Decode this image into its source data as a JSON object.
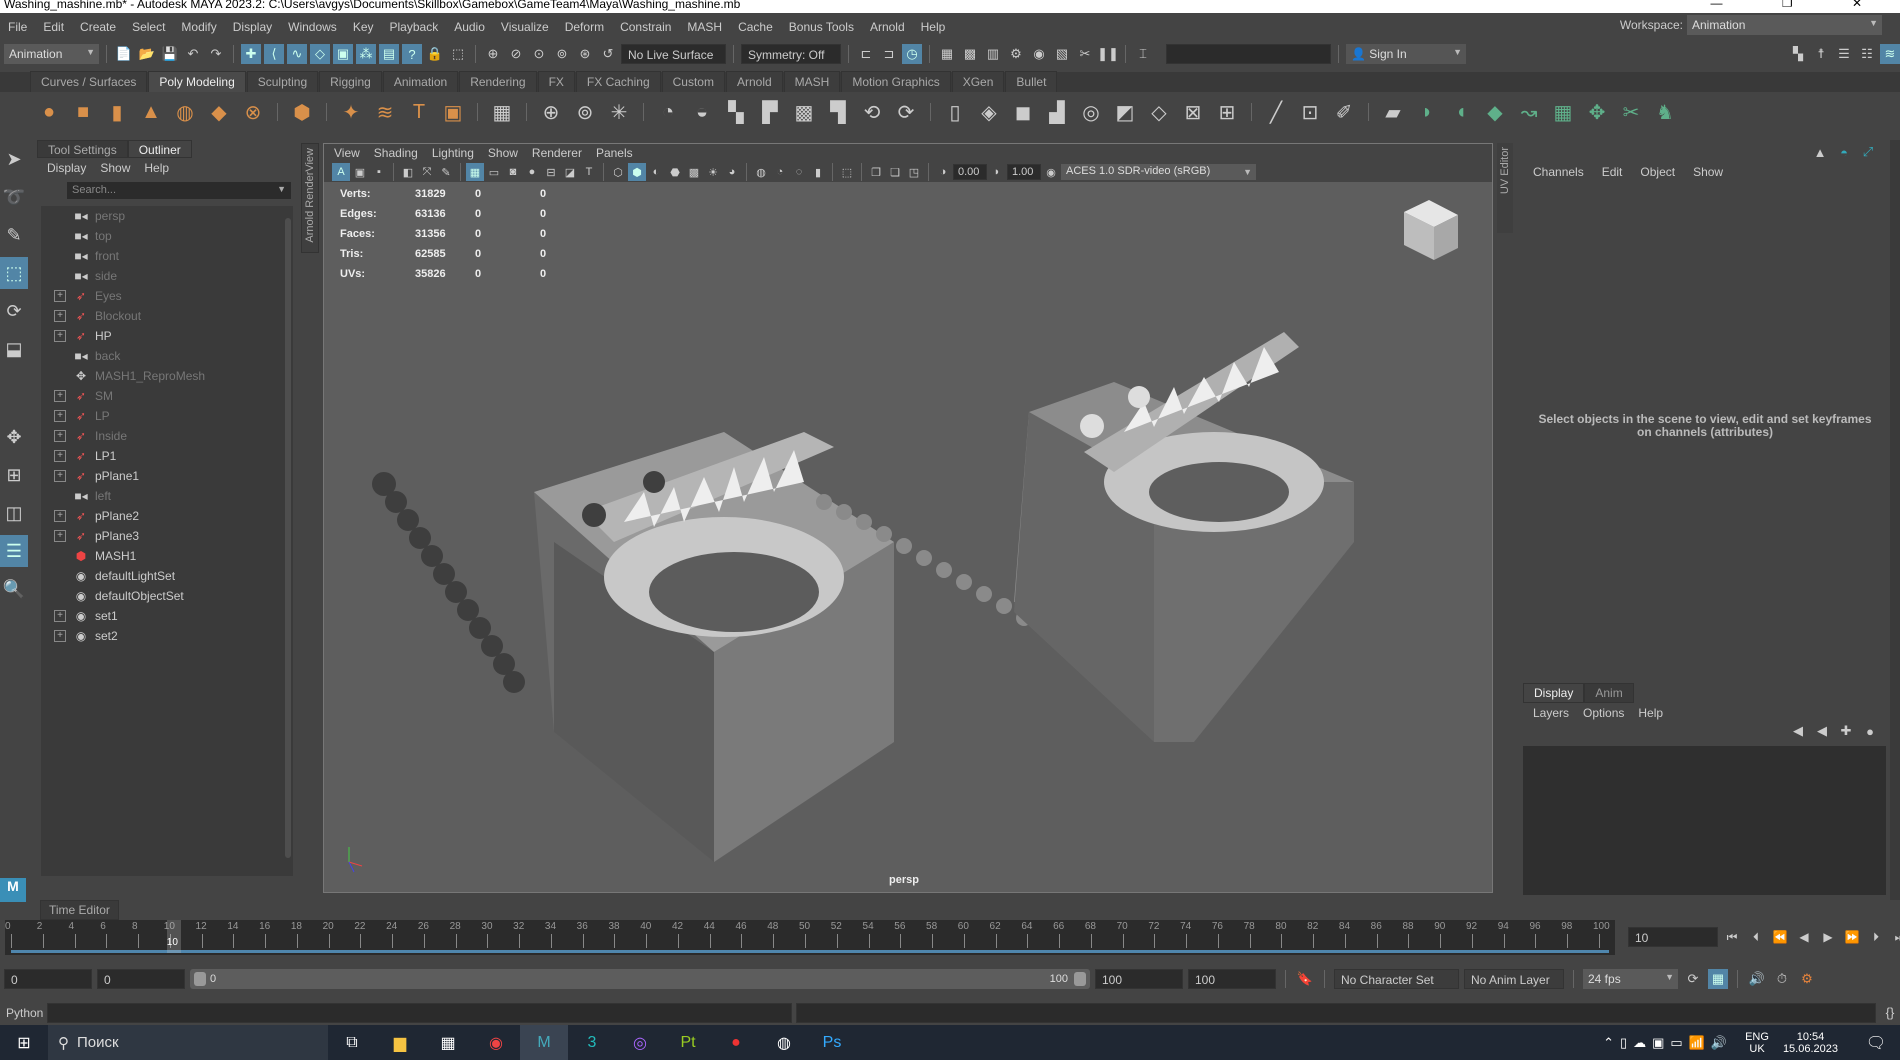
{
  "window": {
    "title": "Washing_mashine.mb* - Autodesk MAYA 2023.2: C:\\Users\\avgys\\Documents\\Skillbox\\Gamebox\\GameTeam4\\Maya\\Washing_mashine.mb",
    "controls": "—  ❐  ✕"
  },
  "menubar": {
    "items": [
      "File",
      "Edit",
      "Create",
      "Select",
      "Modify",
      "Display",
      "Windows",
      "Key",
      "Playback",
      "Audio",
      "Visualize",
      "Deform",
      "Constrain",
      "MASH",
      "Cache",
      "Bonus Tools",
      "Arnold",
      "Help"
    ],
    "workspace_label": "Workspace:",
    "workspace_value": "Animation"
  },
  "statusline": {
    "menuset": "Animation",
    "live_surface": "No Live Surface",
    "symmetry": "Symmetry: Off",
    "sign_in": "Sign In"
  },
  "shelf": {
    "tabs": [
      "Curves / Surfaces",
      "Poly Modeling",
      "Sculpting",
      "Rigging",
      "Animation",
      "Rendering",
      "FX",
      "FX Caching",
      "Custom",
      "Arnold",
      "MASH",
      "Motion Graphics",
      "XGen",
      "Bullet"
    ],
    "active_tab": "Poly Modeling",
    "accent": "#d9904a"
  },
  "outliner": {
    "tabs": [
      "Tool Settings",
      "Outliner"
    ],
    "active_tab": "Outliner",
    "menu": [
      "Display",
      "Show",
      "Help"
    ],
    "search_placeholder": "Search...",
    "items": [
      {
        "name": "persp",
        "icon": "camera",
        "expand": false,
        "dim": true
      },
      {
        "name": "top",
        "icon": "camera",
        "expand": false,
        "dim": true
      },
      {
        "name": "front",
        "icon": "camera",
        "expand": false,
        "dim": true
      },
      {
        "name": "side",
        "icon": "camera",
        "expand": false,
        "dim": true
      },
      {
        "name": "Eyes",
        "icon": "group",
        "expand": true,
        "dim": true
      },
      {
        "name": "Blockout",
        "icon": "group",
        "expand": true,
        "dim": true
      },
      {
        "name": "HP",
        "icon": "group",
        "expand": true,
        "dim": false
      },
      {
        "name": "back",
        "icon": "camera",
        "expand": false,
        "dim": true
      },
      {
        "name": "MASH1_ReproMesh",
        "icon": "mesh",
        "expand": false,
        "dim": true
      },
      {
        "name": "SM",
        "icon": "group",
        "expand": true,
        "dim": true
      },
      {
        "name": "LP",
        "icon": "group",
        "expand": true,
        "dim": true
      },
      {
        "name": "Inside",
        "icon": "group",
        "expand": true,
        "dim": true
      },
      {
        "name": "LP1",
        "icon": "group",
        "expand": true,
        "dim": false
      },
      {
        "name": "pPlane1",
        "icon": "group",
        "expand": true,
        "dim": false
      },
      {
        "name": "left",
        "icon": "camera",
        "expand": false,
        "dim": true
      },
      {
        "name": "pPlane2",
        "icon": "group",
        "expand": true,
        "dim": false
      },
      {
        "name": "pPlane3",
        "icon": "group",
        "expand": true,
        "dim": false
      },
      {
        "name": "MASH1",
        "icon": "mash",
        "expand": false,
        "dim": false
      },
      {
        "name": "defaultLightSet",
        "icon": "set",
        "expand": false,
        "dim": false
      },
      {
        "name": "defaultObjectSet",
        "icon": "set",
        "expand": false,
        "dim": false
      },
      {
        "name": "set1",
        "icon": "set",
        "expand": true,
        "dim": false
      },
      {
        "name": "set2",
        "icon": "set",
        "expand": true,
        "dim": false
      }
    ]
  },
  "side_tabs": {
    "arnold": "Arnold RenderView",
    "uv": "UV Editor"
  },
  "viewport": {
    "menu": [
      "View",
      "Shading",
      "Lighting",
      "Show",
      "Renderer",
      "Panels"
    ],
    "exposure": "0.00",
    "gamma": "1.00",
    "color_space": "ACES 1.0 SDR-video (sRGB)",
    "stats": [
      {
        "label": "Verts:",
        "v": "31829",
        "a": "0",
        "b": "0"
      },
      {
        "label": "Edges:",
        "v": "63136",
        "a": "0",
        "b": "0"
      },
      {
        "label": "Faces:",
        "v": "31356",
        "a": "0",
        "b": "0"
      },
      {
        "label": "Tris:",
        "v": "62585",
        "a": "0",
        "b": "0"
      },
      {
        "label": "UVs:",
        "v": "35826",
        "a": "0",
        "b": "0"
      }
    ],
    "camera": "persp"
  },
  "channelbox": {
    "menu": [
      "Channels",
      "Edit",
      "Object",
      "Show"
    ],
    "message": "Select objects in the scene to view, edit and set keyframes on channels (attributes)",
    "layer_tabs": [
      "Display",
      "Anim"
    ],
    "layer_active": "Display",
    "layer_menu": [
      "Layers",
      "Options",
      "Help"
    ]
  },
  "timeline": {
    "tab": "Time Editor",
    "start": 0,
    "end": 100,
    "step": 2,
    "current": 10,
    "current_frame": "10"
  },
  "range": {
    "start": "0",
    "anim_start": "0",
    "slider_start": "0",
    "slider_end": "100",
    "playback_end": "100",
    "anim_end": "100",
    "character_set": "No Character Set",
    "anim_layer": "No Anim Layer",
    "fps": "24 fps"
  },
  "command": {
    "label": "Python"
  },
  "taskbar": {
    "search": "Поиск",
    "lang": "ENG",
    "locale": "UK",
    "time": "10:54",
    "date": "15.06.2023"
  }
}
